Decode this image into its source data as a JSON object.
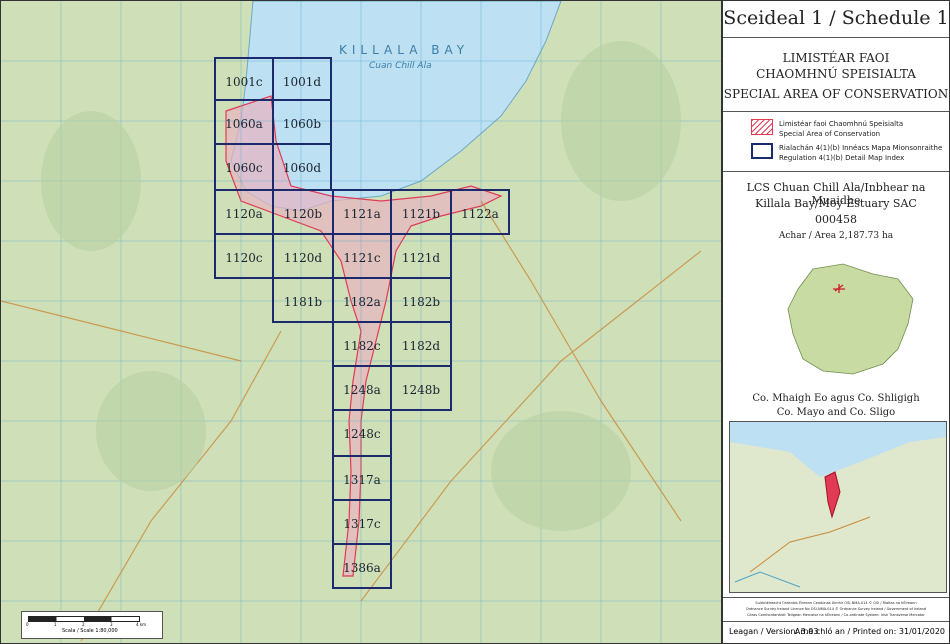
{
  "map": {
    "water_label": "KILLALA BAY",
    "water_label_irish": "Cuan Chill Ala",
    "scale_label": "Scala / Scale 1:80,000",
    "scale_ticks": [
      "0",
      "1",
      "2",
      "3",
      "4 km"
    ],
    "tiles": [
      "1001c",
      "1001d",
      "1060a",
      "1060b",
      "1060c",
      "1060d",
      "1120a",
      "1120b",
      "1121a",
      "1121b",
      "1122a",
      "1120c",
      "1120d",
      "1121c",
      "1121d",
      "1181b",
      "1182a",
      "1182b",
      "1182c",
      "1182d",
      "1248a",
      "1248b",
      "1248c",
      "1317a",
      "1317c",
      "1386a"
    ],
    "colors": {
      "land": "#cfe0b8",
      "water": "#bde0f3",
      "grid": "#4aa3c9",
      "tile_border": "#1a2a6c",
      "sac": "#e03a55"
    }
  },
  "panel": {
    "title": "Sceideal 1 / Schedule 1",
    "heading_irish_1": "LIMISTÉAR FAOI",
    "heading_irish_2": "CHAOMHNÚ SPEISIALTA",
    "heading_english": "SPECIAL AREA OF CONSERVATION",
    "legend": {
      "sac_irish": "Limistéar faoi Chaomhnú Speisialta",
      "sac_english": "Special Area of Conservation",
      "index_irish": "Rialachán 4(1)(b) Innéacs Mapa Mionsonraithe",
      "index_english": "Regulation 4(1)(b) Detail Map Index"
    },
    "site_irish": "LCS Chuan Chill Ala/Inbhear na Muaidhe",
    "site_english": "Killala Bay/Moy Estuary SAC",
    "site_code": "000458",
    "area": "Achar / Area 2,187.73 ha",
    "county_irish": "Co. Mhaigh Eo agus Co. Shligigh",
    "county_english": "Co. Mayo and Co. Sligo",
    "copyright_lines": [
      "Suirbhéireacht Ordanáis Éireann Ceadúnas Uimhir OSI-NMA-014 © OSi / Rialtas na hÉireann",
      "Ordnance Survey Ireland Licence No OSI-NMA-014 © Ordnance Survey Ireland / Government of Ireland",
      "Córas Comhordanáidí: Teilgean Mercator na hÉireann / Co-ordinate System: Irish Transverse Mercator"
    ],
    "version": "Leagan / Version: 3.03",
    "printed": "Arna chló an / Printed on: 31/01/2020"
  }
}
